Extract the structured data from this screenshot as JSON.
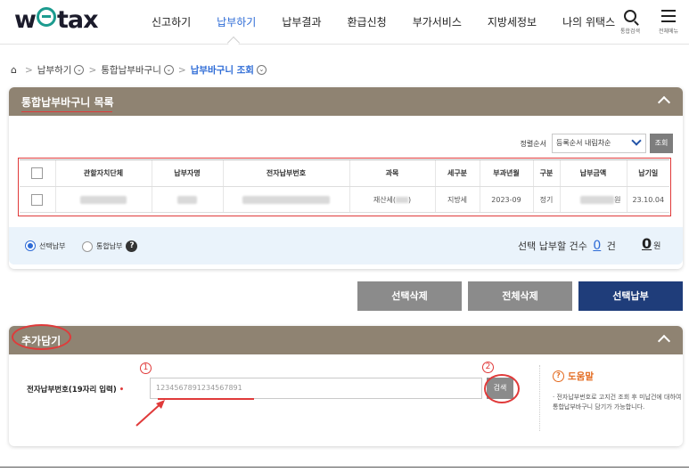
{
  "header": {
    "logo_pre": "w",
    "logo_post": "tax",
    "nav": [
      {
        "label": "신고하기"
      },
      {
        "label": "납부하기",
        "active": true
      },
      {
        "label": "납부결과"
      },
      {
        "label": "환급신청"
      },
      {
        "label": "부가서비스"
      },
      {
        "label": "지방세정보"
      },
      {
        "label": "나의 위택스"
      }
    ],
    "search_label": "통합검색",
    "menu_label": "전체메뉴"
  },
  "breadcrumb": {
    "items": [
      "납부하기",
      "통합납부바구니"
    ],
    "current": "납부바구니 조회"
  },
  "basket_panel": {
    "title": "통합납부바구니 목록",
    "sort_label": "정렬순서",
    "sort_value": "등록순서 내림차순",
    "sort_button": "조회",
    "columns": [
      "관할자치단체",
      "납부자명",
      "전자납부번호",
      "과목",
      "세구분",
      "부과년월",
      "구분",
      "납부금액",
      "납기일"
    ],
    "rows": [
      {
        "subject": "재산세(",
        "subject_end": ")",
        "tax_type": "지방세",
        "period": "2023-09",
        "kind": "정기",
        "amount_unit": "원",
        "due": "23.10.04"
      }
    ],
    "radio_select": "선택납부",
    "radio_total": "통합납부",
    "count_label": "선택 납부할 건수",
    "count_value": "0",
    "count_unit": "건",
    "amount_value": "0",
    "amount_unit": "원"
  },
  "actions": {
    "delete_selected": "선택삭제",
    "delete_all": "전체삭제",
    "pay_selected": "선택납부"
  },
  "add_panel": {
    "title": "추가담기",
    "field_label": "전자납부번호(19자리 입력)",
    "required_mark": "•",
    "input_value": "1234567891234567891",
    "search_button": "검색",
    "help_title": "도움말",
    "help_text": "· 전자납부번호로 고지건 조회 후 미납건에 대하여 통합납부바구니 담기가 가능합니다.",
    "marker_1": "1",
    "marker_2": "2"
  },
  "colors": {
    "brand_teal": "#1c9b8f",
    "accent_blue": "#2d6bd6",
    "panel_header": "#8f8372",
    "navy_button": "#1f3d7a",
    "annotation_red": "#e03a3a"
  }
}
